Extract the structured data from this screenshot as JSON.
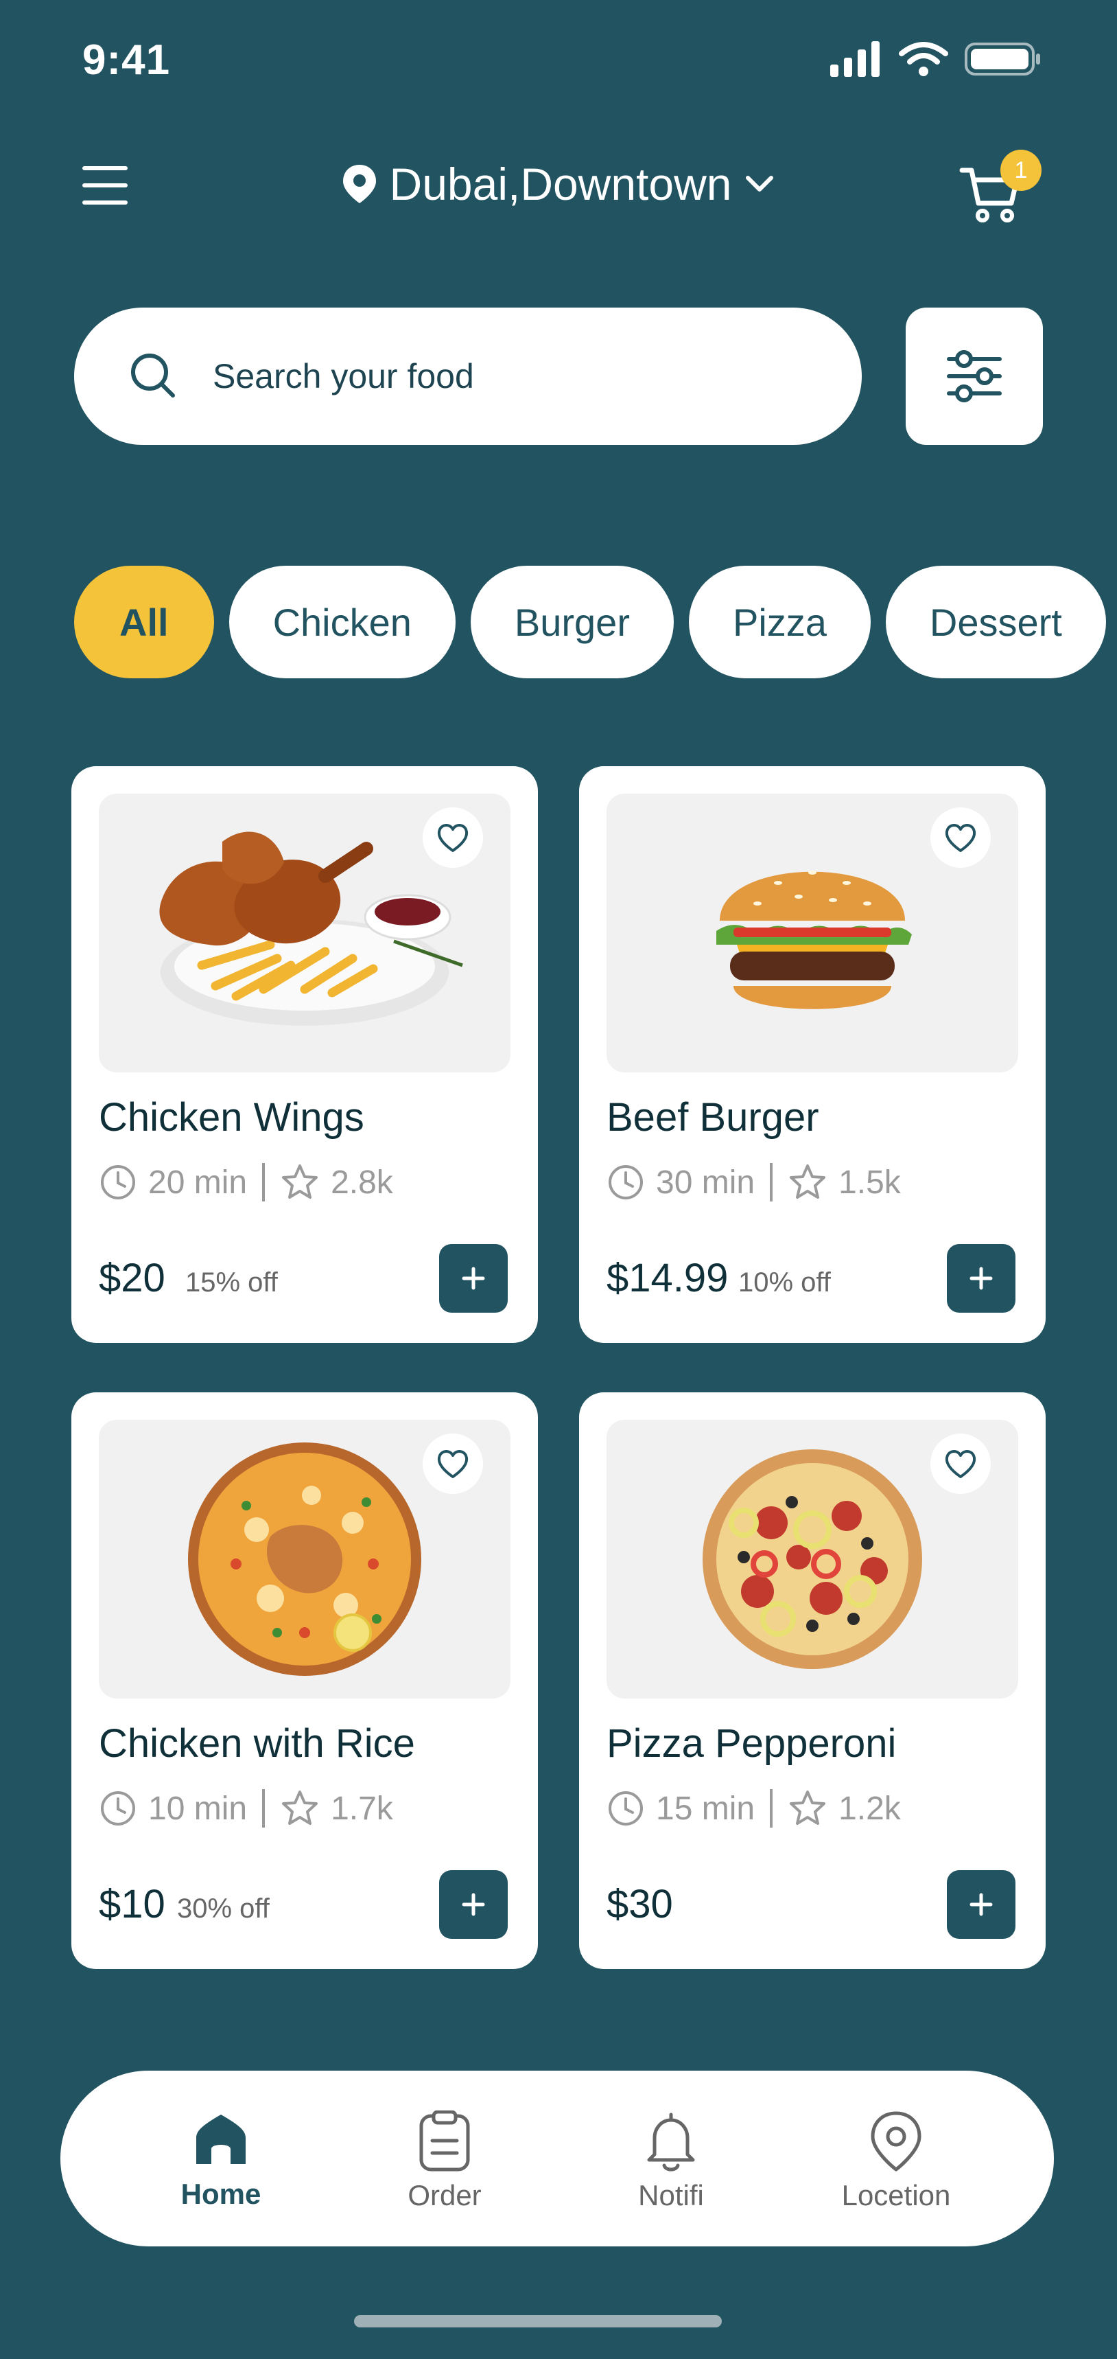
{
  "status": {
    "time": "9:41"
  },
  "header": {
    "location": "Dubai,Downtown",
    "cart_count": "1"
  },
  "search": {
    "placeholder": "Search your food"
  },
  "categories": [
    "All",
    "Chicken",
    "Burger",
    "Pizza",
    "Dessert"
  ],
  "products": [
    {
      "name": "Chicken Wings",
      "time": "20 min",
      "rating": "2.8k",
      "price": "$20",
      "discount": "15% off"
    },
    {
      "name": "Beef Burger",
      "time": "30 min",
      "rating": "1.5k",
      "price": "$14.99",
      "discount": "10% off"
    },
    {
      "name": "Chicken with Rice",
      "time": "10 min",
      "rating": "1.7k",
      "price": "$10",
      "discount": "30% off"
    },
    {
      "name": "Pizza Pepperoni",
      "time": "15 min",
      "rating": "1.2k",
      "price": "$30",
      "discount": ""
    }
  ],
  "nav": {
    "home": "Home",
    "order": "Order",
    "notifi": "Notifi",
    "location": "Locetion"
  },
  "colors": {
    "primary": "#225361",
    "accent": "#f4c33a",
    "card": "#ffffff"
  }
}
